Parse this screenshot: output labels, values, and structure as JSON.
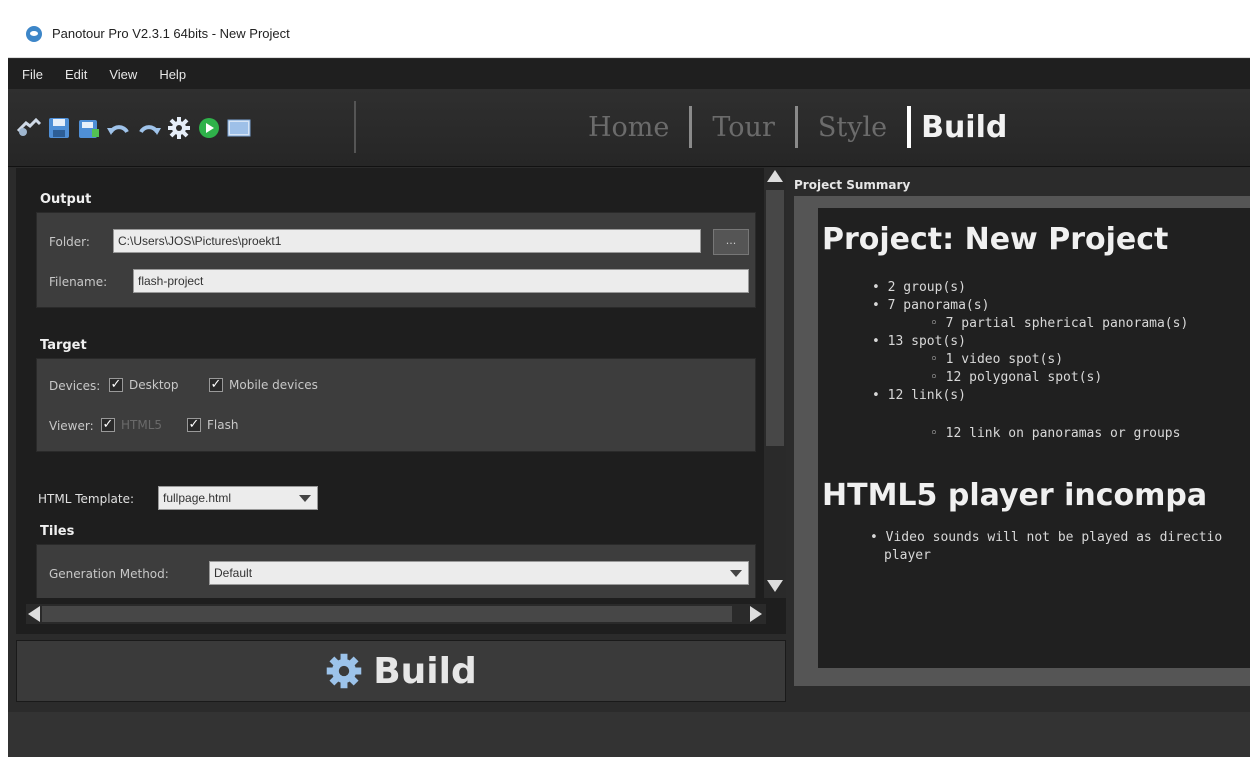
{
  "window": {
    "title": "Panotour Pro V2.3.1 64bits - New Project"
  },
  "menu": [
    "File",
    "Edit",
    "View",
    "Help"
  ],
  "toolbar": {
    "icons": [
      "open-icon",
      "save-icon",
      "save-as-icon",
      "undo-icon",
      "redo-icon",
      "settings-icon",
      "play-icon",
      "image-icon"
    ]
  },
  "nav": {
    "tabs": [
      "Home",
      "Tour",
      "Style",
      "Build"
    ],
    "active": "Build"
  },
  "output": {
    "section": "Output",
    "folder_label": "Folder:",
    "folder_value": "C:\\Users\\JOS\\Pictures\\proekt1",
    "browse": "...",
    "filename_label": "Filename:",
    "filename_value": "flash-project"
  },
  "target": {
    "section": "Target",
    "devices_label": "Devices:",
    "desktop": "Desktop",
    "mobile": "Mobile devices",
    "viewer_label": "Viewer:",
    "html5": "HTML5",
    "flash": "Flash"
  },
  "template": {
    "label": "HTML Template:",
    "value": "fullpage.html"
  },
  "tiles": {
    "section": "Tiles",
    "method_label": "Generation Method:",
    "method_value": "Default"
  },
  "build_button": "Build",
  "summary": {
    "header": "Project Summary",
    "title": "Project: New Project",
    "items": [
      "• 2 group(s)",
      "• 7 panorama(s)",
      "◦ 7 partial spherical panorama(s)",
      "• 13 spot(s)",
      "◦ 1 video spot(s)",
      "◦ 12 polygonal spot(s)",
      "• 12 link(s)",
      "◦ 12 link on panoramas or groups"
    ],
    "heading2": "HTML5 player incompa",
    "note_line1": "• Video sounds will not be played as directio",
    "note_line2": "player"
  },
  "colors": {
    "background": "#2b2b2b",
    "panel": "#1e1e1e",
    "group": "#3d3d3d",
    "active_tab": "#f2f2f2",
    "inactive_tab": "#6b6b6b"
  }
}
